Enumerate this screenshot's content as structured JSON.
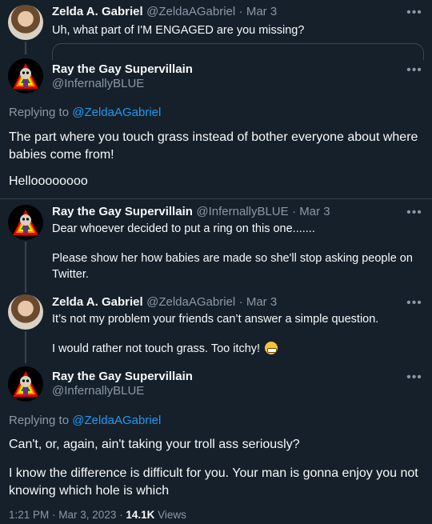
{
  "tweets": [
    {
      "name": "Zelda A. Gabriel",
      "handle": "@ZeldaAGabriel",
      "date": "· Mar 3",
      "text": "Uh, what part of I'M ENGAGED are you missing?"
    },
    {
      "name": "Ray the Gay Supervillain",
      "handle": "@InfernallyBLUE",
      "replying_to_label": "Replying to",
      "replying_to_handle": "@ZeldaAGabriel",
      "text_p1": "The part where you touch grass instead of bother everyone about where babies come from!",
      "text_p2": "Helloooooooo"
    },
    {
      "name": "Ray the Gay Supervillain",
      "handle": "@InfernallyBLUE",
      "date": "· Mar 3",
      "text_p1": "Dear whoever decided to put a ring on this one.......",
      "text_p2": "Please show her how babies are made so she'll stop asking people on Twitter."
    },
    {
      "name": "Zelda A. Gabriel",
      "handle": "@ZeldaAGabriel",
      "date": "· Mar 3",
      "text_p1": "It’s not my problem your friends can’t answer a simple question.",
      "text_p2": "I would rather not touch grass. Too itchy!"
    },
    {
      "name": "Ray the Gay Supervillain",
      "handle": "@InfernallyBLUE",
      "replying_to_label": "Replying to",
      "replying_to_handle": "@ZeldaAGabriel",
      "text_p1": "Can't, or, again, ain't taking your troll ass seriously?",
      "text_p2": "I know the difference is difficult for you. Your man is gonna enjoy you not knowing which hole is which"
    }
  ],
  "footer": {
    "time": "1:21 PM",
    "date": "· Mar 3, 2023 ·",
    "views_count": "14.1K",
    "views_label": "Views"
  },
  "icons": {
    "more": "more-horizontal-icon",
    "emoji": "grimacing-face-emoji"
  },
  "colors": {
    "background": "#15202b",
    "text": "#f7f9f9",
    "muted": "#8b98a5",
    "link": "#1d9bf0"
  }
}
